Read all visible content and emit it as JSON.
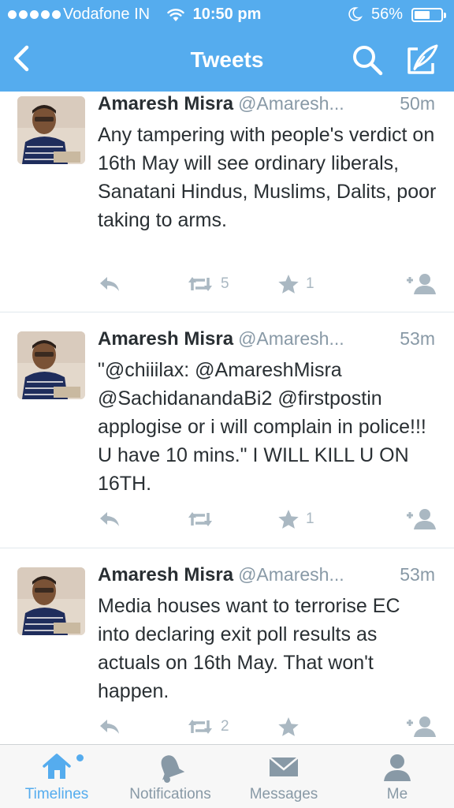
{
  "status_bar": {
    "carrier": "Vodafone IN",
    "time": "10:50 pm",
    "battery": "56%",
    "battery_level": 0.56
  },
  "nav": {
    "title": "Tweets",
    "back_icon": "chevron-left-icon",
    "search_icon": "search-icon",
    "compose_icon": "compose-icon"
  },
  "tweets": [
    {
      "name": "Amaresh Misra",
      "handle": "@Amaresh...",
      "time": "50m",
      "text": "Any tampering with people's verdict on 16th May will see ordinary liberals, Sanatani Hindus, Muslims, Dalits, poor taking to arms.",
      "retweets": "5",
      "favorites": "1"
    },
    {
      "name": "Amaresh Misra",
      "handle": "@Amaresh...",
      "time": "53m",
      "text": "\"@chiiilax: @AmareshMisra @SachidanandaBi2 @firstpostin applogise or i will complain in police!!! U have 10 mins.\" I WILL KILL U ON 16TH.",
      "retweets": "",
      "favorites": "1"
    },
    {
      "name": "Amaresh Misra",
      "handle": "@Amaresh...",
      "time": "53m",
      "text": "Media houses want to terrorise EC into declaring exit poll results as actuals on 16th May. That won't happen.",
      "retweets": "2",
      "favorites": ""
    }
  ],
  "tabbar": {
    "tabs": [
      {
        "label": "Timelines",
        "icon": "home-icon",
        "active": true
      },
      {
        "label": "Notifications",
        "icon": "bell-icon",
        "active": false
      },
      {
        "label": "Messages",
        "icon": "envelope-icon",
        "active": false
      },
      {
        "label": "Me",
        "icon": "person-icon",
        "active": false
      }
    ]
  },
  "colors": {
    "brand": "#55acee",
    "muted": "#8899a6",
    "text": "#292f33"
  }
}
